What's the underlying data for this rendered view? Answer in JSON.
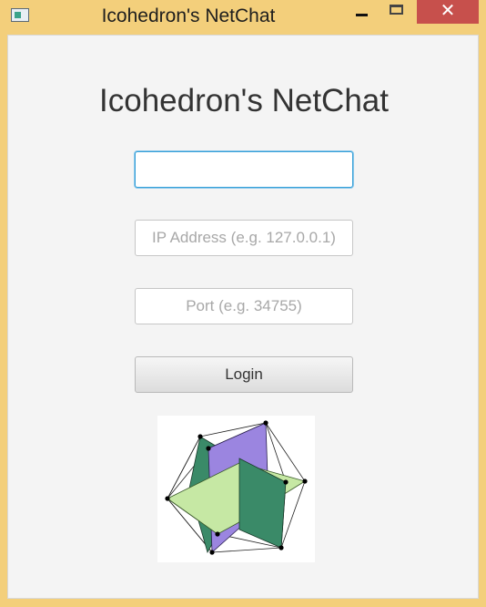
{
  "window": {
    "title": "Icohedron's NetChat",
    "close_glyph": "✕"
  },
  "main": {
    "heading": "Icohedron's NetChat",
    "username_value": "",
    "ip_placeholder": "IP Address (e.g. 127.0.0.1)",
    "port_placeholder": "Port (e.g. 34755)",
    "login_label": "Login"
  },
  "logo": {
    "icon": "icosahedron-logo",
    "colors": {
      "purple": "#9b85e0",
      "green": "#3a8a68",
      "light_green": "#c6e8a4"
    }
  },
  "colors": {
    "titlebar": "#f3cf7b",
    "close": "#c7504c",
    "focus": "#36a0d8"
  }
}
